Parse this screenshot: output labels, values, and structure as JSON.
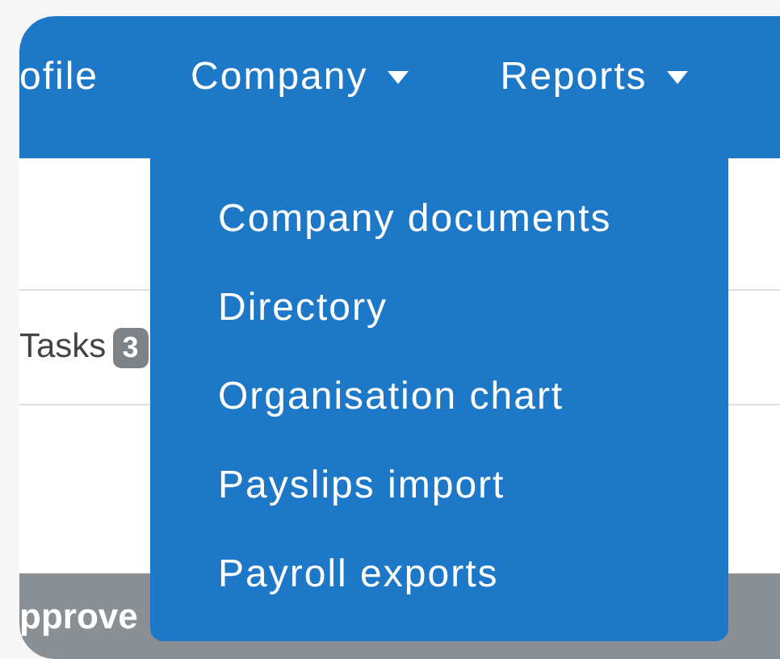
{
  "navbar": {
    "items": [
      {
        "label": "ofile",
        "dropdown": false,
        "expanded": false
      },
      {
        "label": "Company",
        "dropdown": true,
        "expanded": true
      },
      {
        "label": "Reports",
        "dropdown": true,
        "expanded": false
      }
    ]
  },
  "dropdown_menu": {
    "items": [
      "Company documents",
      "Directory",
      "Organisation chart",
      "Payslips import",
      "Payroll exports"
    ]
  },
  "content": {
    "tab": {
      "label": "Tasks",
      "badge": "3"
    },
    "footer_bar": {
      "label": "pprove"
    }
  }
}
